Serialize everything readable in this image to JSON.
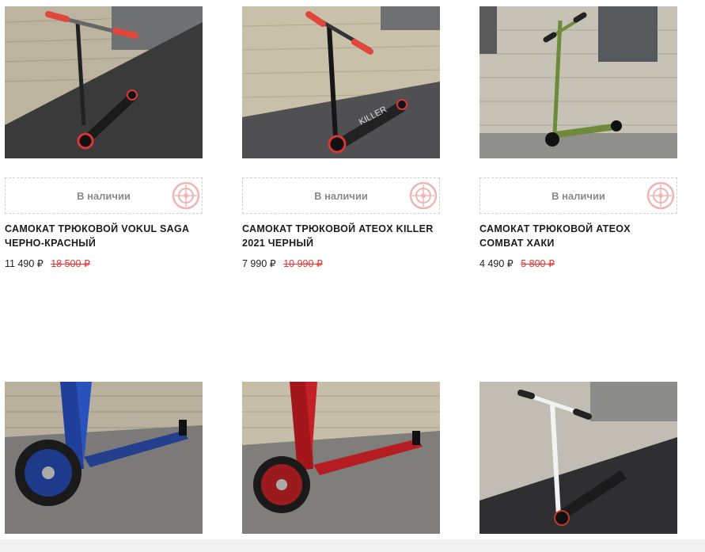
{
  "products": [
    {
      "stock": "В наличии",
      "title": "САМОКАТ ТРЮКОВОЙ VOKUL SAGA ЧЕРНО-КРАСНЫЙ",
      "price": "11 490 ₽",
      "old_price": "18 500 ₽",
      "image": "black-red-scooter"
    },
    {
      "stock": "В наличии",
      "title": "САМОКАТ ТРЮКОВОЙ ATEOX KILLER 2021 ЧЕРНЫЙ",
      "price": "7 990 ₽",
      "old_price": "10 990 ₽",
      "image": "black-killer-scooter"
    },
    {
      "stock": "В наличии",
      "title": "САМОКАТ ТРЮКОВОЙ ATEOX COMBAT ХАКИ",
      "price": "4 490 ₽",
      "old_price": "5 800 ₽",
      "image": "khaki-scooter"
    },
    {
      "image": "blue-scooter"
    },
    {
      "image": "red-scooter"
    },
    {
      "image": "white-scooter"
    }
  ],
  "colors": {
    "accent": "#e8332f",
    "text": "#1c1c1c",
    "muted": "#8a8a8a"
  },
  "icons": {
    "stock_badge": "wheel-badge-icon"
  }
}
